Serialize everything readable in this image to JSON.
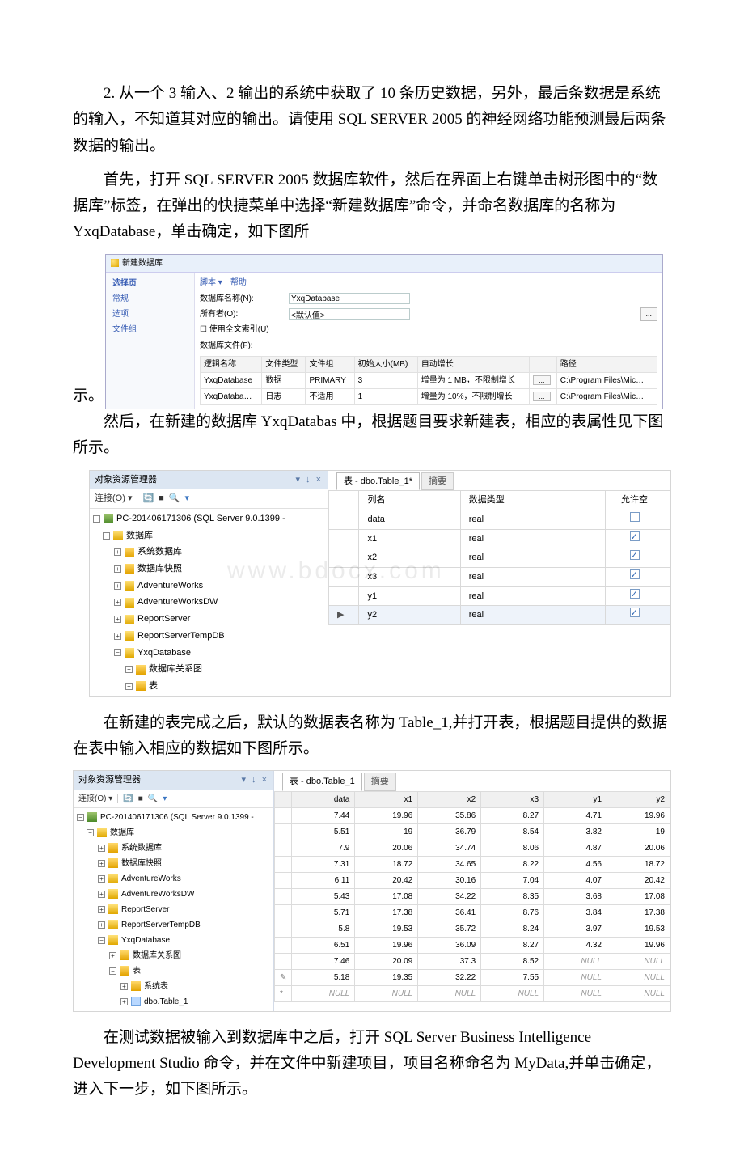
{
  "paragraphs": {
    "p1": "2. 从一个 3 输入、2 输出的系统中获取了 10 条历史数据，另外，最后条数据是系统的输入，不知道其对应的输出。请使用 SQL SERVER 2005 的神经网络功能预测最后两条数据的输出。",
    "p2_a": "首先，打开 SQL SERVER 2005 数据库软件，然后在界面上右键单击树形图中的“数据库”标签，在弹出的快捷菜单中选择“新建数据库”命令，并命名数据库的名称为 YxqDatabase，单击确定，如下图所",
    "p2_b": "示。",
    "p3": "然后，在新建的数据库 YxqDatabas 中，根据题目要求新建表，相应的表属性见下图所示。",
    "p4": "在新建的表完成之后，默认的数据表名称为 Table_1,并打开表，根据题目提供的数据在表中输入相应的数据如下图所示。",
    "p5": "在测试数据被输入到数据库中之后，打开 SQL Server Business Intelligence Development Studio 命令，并在文件中新建项目，项目名称命名为 MyData,并单击确定，进入下一步，如下图所示。"
  },
  "fig1": {
    "title": "新建数据库",
    "left_nodes": [
      "常规",
      "选项",
      "文件组"
    ],
    "left_head": "选择页",
    "toolbar": [
      "脚本 ▾",
      "帮助"
    ],
    "name_label": "数据库名称(N):",
    "name_value": "YxqDatabase",
    "owner_label": "所有者(O):",
    "owner_value": "<默认值>",
    "owner_btn": "...",
    "fulltext": "使用全文索引(U)",
    "files_label": "数据库文件(F):",
    "cols": [
      "逻辑名称",
      "文件类型",
      "文件组",
      "初始大小(MB)",
      "自动增长",
      "",
      "路径"
    ],
    "rows": [
      [
        "YxqDatabase",
        "数据",
        "PRIMARY",
        "3",
        "增量为 1 MB，不限制增长",
        "...",
        "C:\\Program Files\\Mic…"
      ],
      [
        "YxqDataba…",
        "日志",
        "不适用",
        "1",
        "增量为 10%，不限制增长",
        "...",
        "C:\\Program Files\\Mic…"
      ]
    ]
  },
  "fig2": {
    "oe_title": "对象资源管理器",
    "oe_pins": "▾ ↓ ×",
    "oe_connect": "连接(O) ▾",
    "server": "PC-201406171306 (SQL Server 9.0.1399 -",
    "nodes": {
      "db": "数据库",
      "sysdb": "系统数据库",
      "snap": "数据库快照",
      "aw": "AdventureWorks",
      "awdw": "AdventureWorksDW",
      "rs": "ReportServer",
      "rstmp": "ReportServerTempDB",
      "yxq": "YxqDatabase",
      "diag": "数据库关系图",
      "tbl": "表",
      "systbl": "系统表",
      "t1": "dbo.Table_1"
    },
    "tab_active": "表 - dbo.Table_1*",
    "tab_inactive": "摘要",
    "cols": [
      "列名",
      "数据类型",
      "允许空"
    ],
    "rows": [
      [
        "data",
        "real",
        false
      ],
      [
        "x1",
        "real",
        true
      ],
      [
        "x2",
        "real",
        true
      ],
      [
        "x3",
        "real",
        true
      ],
      [
        "y1",
        "real",
        true
      ],
      [
        "y2",
        "real",
        true
      ]
    ],
    "watermark": "www.bdocx.com"
  },
  "fig3": {
    "tab_active": "表 - dbo.Table_1",
    "tab_inactive": "摘要",
    "cols": [
      "",
      "data",
      "x1",
      "x2",
      "x3",
      "y1",
      "y2"
    ],
    "rows": [
      [
        "",
        "7.44",
        "19.96",
        "35.86",
        "8.27",
        "4.71",
        "19.96"
      ],
      [
        "",
        "5.51",
        "19",
        "36.79",
        "8.54",
        "3.82",
        "19"
      ],
      [
        "",
        "7.9",
        "20.06",
        "34.74",
        "8.06",
        "4.87",
        "20.06"
      ],
      [
        "",
        "7.31",
        "18.72",
        "34.65",
        "8.22",
        "4.56",
        "18.72"
      ],
      [
        "",
        "6.11",
        "20.42",
        "30.16",
        "7.04",
        "4.07",
        "20.42"
      ],
      [
        "",
        "5.43",
        "17.08",
        "34.22",
        "8.35",
        "3.68",
        "17.08"
      ],
      [
        "",
        "5.71",
        "17.38",
        "36.41",
        "8.76",
        "3.84",
        "17.38"
      ],
      [
        "",
        "5.8",
        "19.53",
        "35.72",
        "8.24",
        "3.97",
        "19.53"
      ],
      [
        "",
        "6.51",
        "19.96",
        "36.09",
        "8.27",
        "4.32",
        "19.96"
      ],
      [
        "",
        "7.46",
        "20.09",
        "37.3",
        "8.52",
        "NULL",
        "NULL"
      ],
      [
        "✎",
        "5.18",
        "19.35",
        "32.22",
        "7.55",
        "NULL",
        "NULL"
      ],
      [
        "*",
        "NULL",
        "NULL",
        "NULL",
        "NULL",
        "NULL",
        "NULL"
      ]
    ]
  },
  "chart_data": {
    "type": "table",
    "title": "dbo.Table_1",
    "columns": [
      "data",
      "x1",
      "x2",
      "x3",
      "y1",
      "y2"
    ],
    "rows": [
      [
        7.44,
        19.96,
        35.86,
        8.27,
        4.71,
        19.96
      ],
      [
        5.51,
        19,
        36.79,
        8.54,
        3.82,
        19
      ],
      [
        7.9,
        20.06,
        34.74,
        8.06,
        4.87,
        20.06
      ],
      [
        7.31,
        18.72,
        34.65,
        8.22,
        4.56,
        18.72
      ],
      [
        6.11,
        20.42,
        30.16,
        7.04,
        4.07,
        20.42
      ],
      [
        5.43,
        17.08,
        34.22,
        8.35,
        3.68,
        17.08
      ],
      [
        5.71,
        17.38,
        36.41,
        8.76,
        3.84,
        17.38
      ],
      [
        5.8,
        19.53,
        35.72,
        8.24,
        3.97,
        19.53
      ],
      [
        6.51,
        19.96,
        36.09,
        8.27,
        4.32,
        19.96
      ],
      [
        7.46,
        20.09,
        37.3,
        8.52,
        null,
        null
      ],
      [
        5.18,
        19.35,
        32.22,
        7.55,
        null,
        null
      ]
    ]
  }
}
